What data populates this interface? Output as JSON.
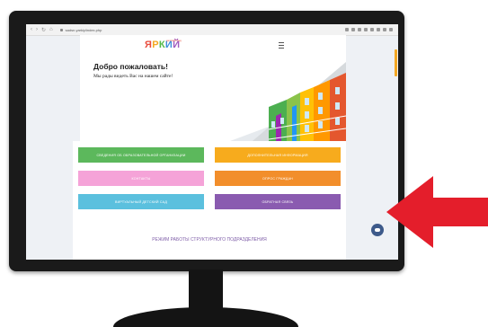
{
  "browser": {
    "url": "sadsn.yarkiy/index.php",
    "nav_icons": [
      "‹",
      "›",
      "↻",
      "⌂"
    ]
  },
  "site": {
    "logo_letters": [
      "Я",
      "Р",
      "К",
      "И",
      "Й"
    ],
    "logo_sub": "детский сад",
    "welcome_title": "Добро пожаловать!",
    "welcome_text": "Мы рады видеть Вас на нашем сайте!"
  },
  "menu": [
    {
      "label": "Сведения об образовательной организации",
      "color": "#5cb85c"
    },
    {
      "label": "Дополнительная информация",
      "color": "#f7ab1d"
    },
    {
      "label": "Контакты",
      "color": "#f5a3d8"
    },
    {
      "label": "Опрос граждан",
      "color": "#f28e2b"
    },
    {
      "label": "Виртуальный детский сад",
      "color": "#5bc0de"
    },
    {
      "label": "Обратная связь",
      "color": "#8a5bb0"
    }
  ],
  "footer": {
    "title": "Режим работы структурного подразделения"
  },
  "colors": {
    "arrow": "#e41e2b",
    "chat": "#3d5a8a"
  }
}
